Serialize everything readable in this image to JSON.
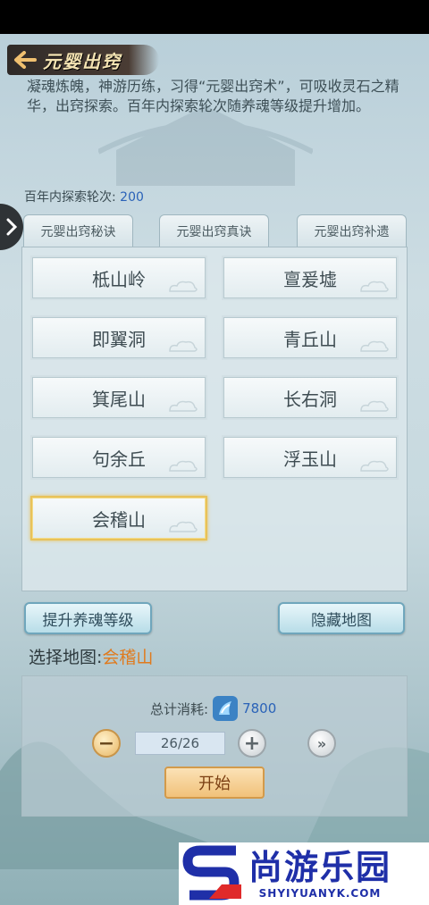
{
  "header": {
    "title": "元婴出窍",
    "back_icon": "back-arrow-icon"
  },
  "description": "凝魂炼魄，神游历练，习得“元婴出窍术”，可吸收灵石之精华，出窍探索。百年内探索轮次随养魂等级提升增加。",
  "explore_count": {
    "label": "百年内探索轮次:",
    "value": "200"
  },
  "tabs": [
    {
      "label": "元婴出窍秘诀"
    },
    {
      "label": "元婴出窍真诀"
    },
    {
      "label": "元婴出窍补遗"
    }
  ],
  "maps": [
    {
      "label": "柢山岭"
    },
    {
      "label": "亶爰墟"
    },
    {
      "label": "即翼洞"
    },
    {
      "label": "青丘山"
    },
    {
      "label": "箕尾山"
    },
    {
      "label": "长右洞"
    },
    {
      "label": "句余丘"
    },
    {
      "label": "浮玉山"
    },
    {
      "label": "会稽山",
      "selected": true
    }
  ],
  "actions": {
    "upgrade_label": "提升养魂等级",
    "hide_label": "隐藏地图"
  },
  "selection": {
    "label": "选择地图:",
    "value": "会稽山"
  },
  "cost": {
    "label": "总计消耗:",
    "value": "7800",
    "icon": "spirit-stone-icon"
  },
  "quantity": {
    "value": "26/26"
  },
  "start_label": "开始",
  "watermark": {
    "cn": "尚游乐园",
    "en": "SHYIYUANYK.COM"
  },
  "colors": {
    "accent_blue": "#2a62b8",
    "selected_orange": "#e07a1d",
    "selected_border": "#e8c25a"
  }
}
